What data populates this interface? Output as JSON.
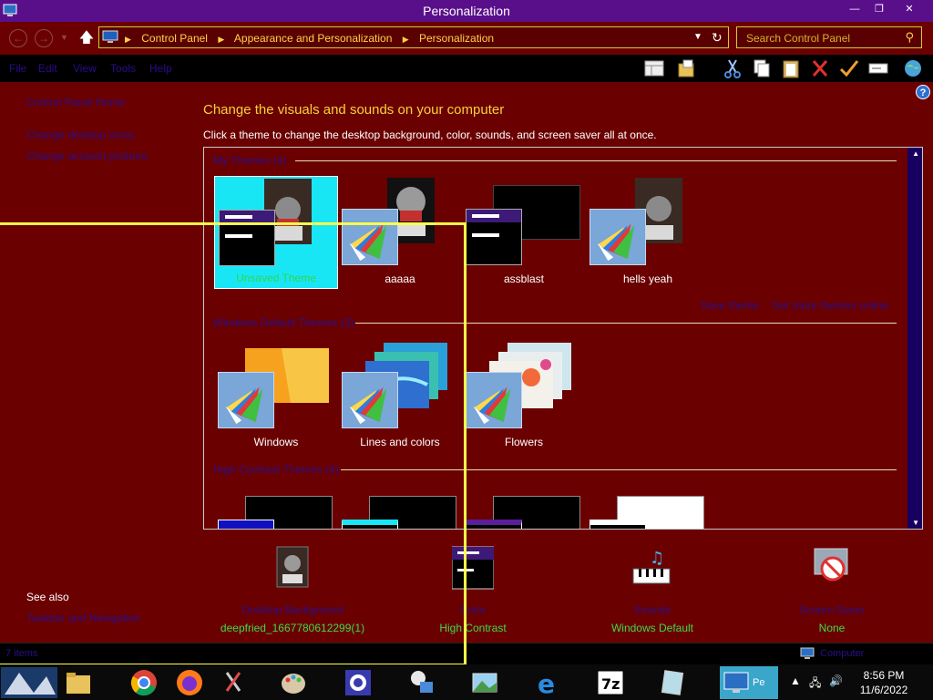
{
  "window": {
    "title": "Personalization",
    "min_glyph": "—",
    "max_glyph": "❐",
    "close_glyph": "✕"
  },
  "nav": {
    "back_glyph": "←",
    "forward_glyph": "→",
    "up_glyph": "🡅",
    "breadcrumbs": [
      "Control Panel",
      "Appearance and Personalization",
      "Personalization"
    ],
    "search_placeholder": "Search Control Panel"
  },
  "menu": {
    "items": [
      "File",
      "Edit",
      "View",
      "Tools",
      "Help"
    ]
  },
  "sidebar": {
    "links": [
      "Control Panel Home",
      "Change desktop icons",
      "Change account pictures"
    ],
    "see_also_title": "See also",
    "see_also_links": [
      "Taskbar and Navigation"
    ]
  },
  "main": {
    "heading": "Change the visuals and sounds on your computer",
    "subheading": "Click a theme to change the desktop background, color, sounds, and screen saver all at once.",
    "groups": [
      {
        "title": "My Themes (4)",
        "themes": [
          {
            "name": "Unsaved Theme",
            "selected": true
          },
          {
            "name": "aaaaa",
            "selected": false
          },
          {
            "name": "assblast",
            "selected": false
          },
          {
            "name": "hells yeah",
            "selected": false
          }
        ]
      },
      {
        "title": "Windows Default Themes (3)",
        "themes": [
          {
            "name": "Windows"
          },
          {
            "name": "Lines and colors"
          },
          {
            "name": "Flowers"
          }
        ]
      },
      {
        "title": "High Contrast Themes (4)",
        "themes": []
      }
    ],
    "save_theme_link": "Save theme",
    "get_more_link": "Get more themes online"
  },
  "customize": [
    {
      "caption": "Desktop Background",
      "value": "deepfried_1667780612299(1)",
      "icon": "desktop-background-icon"
    },
    {
      "caption": "Color",
      "value": "High Contrast",
      "icon": "color-icon"
    },
    {
      "caption": "Sounds",
      "value": "Windows Default",
      "icon": "sounds-icon"
    },
    {
      "caption": "Screen Saver",
      "value": "None",
      "icon": "screen-saver-icon"
    }
  ],
  "statusbar": {
    "left_text": "7 items",
    "right_text": "Computer"
  },
  "taskbar": {
    "active_label": "Pe",
    "time": "8:56 PM",
    "date": "11/6/2022",
    "apps": [
      "Start",
      "File Explorer",
      "Google Chrome",
      "Firefox",
      "Snipping Tool",
      "Paint",
      "Settings",
      "Network",
      "Photos",
      "Internet Explorer",
      "7-Zip",
      "Notepad",
      "Personalization"
    ]
  },
  "colors": {
    "background": "#6b0000",
    "titlebar": "#5a0f8a",
    "heading": "#f5d23a",
    "link": "#2a0f8a",
    "selected_tile": "#19e6f5",
    "value_text": "#3ed94a",
    "overlay": "#ffff4a"
  }
}
